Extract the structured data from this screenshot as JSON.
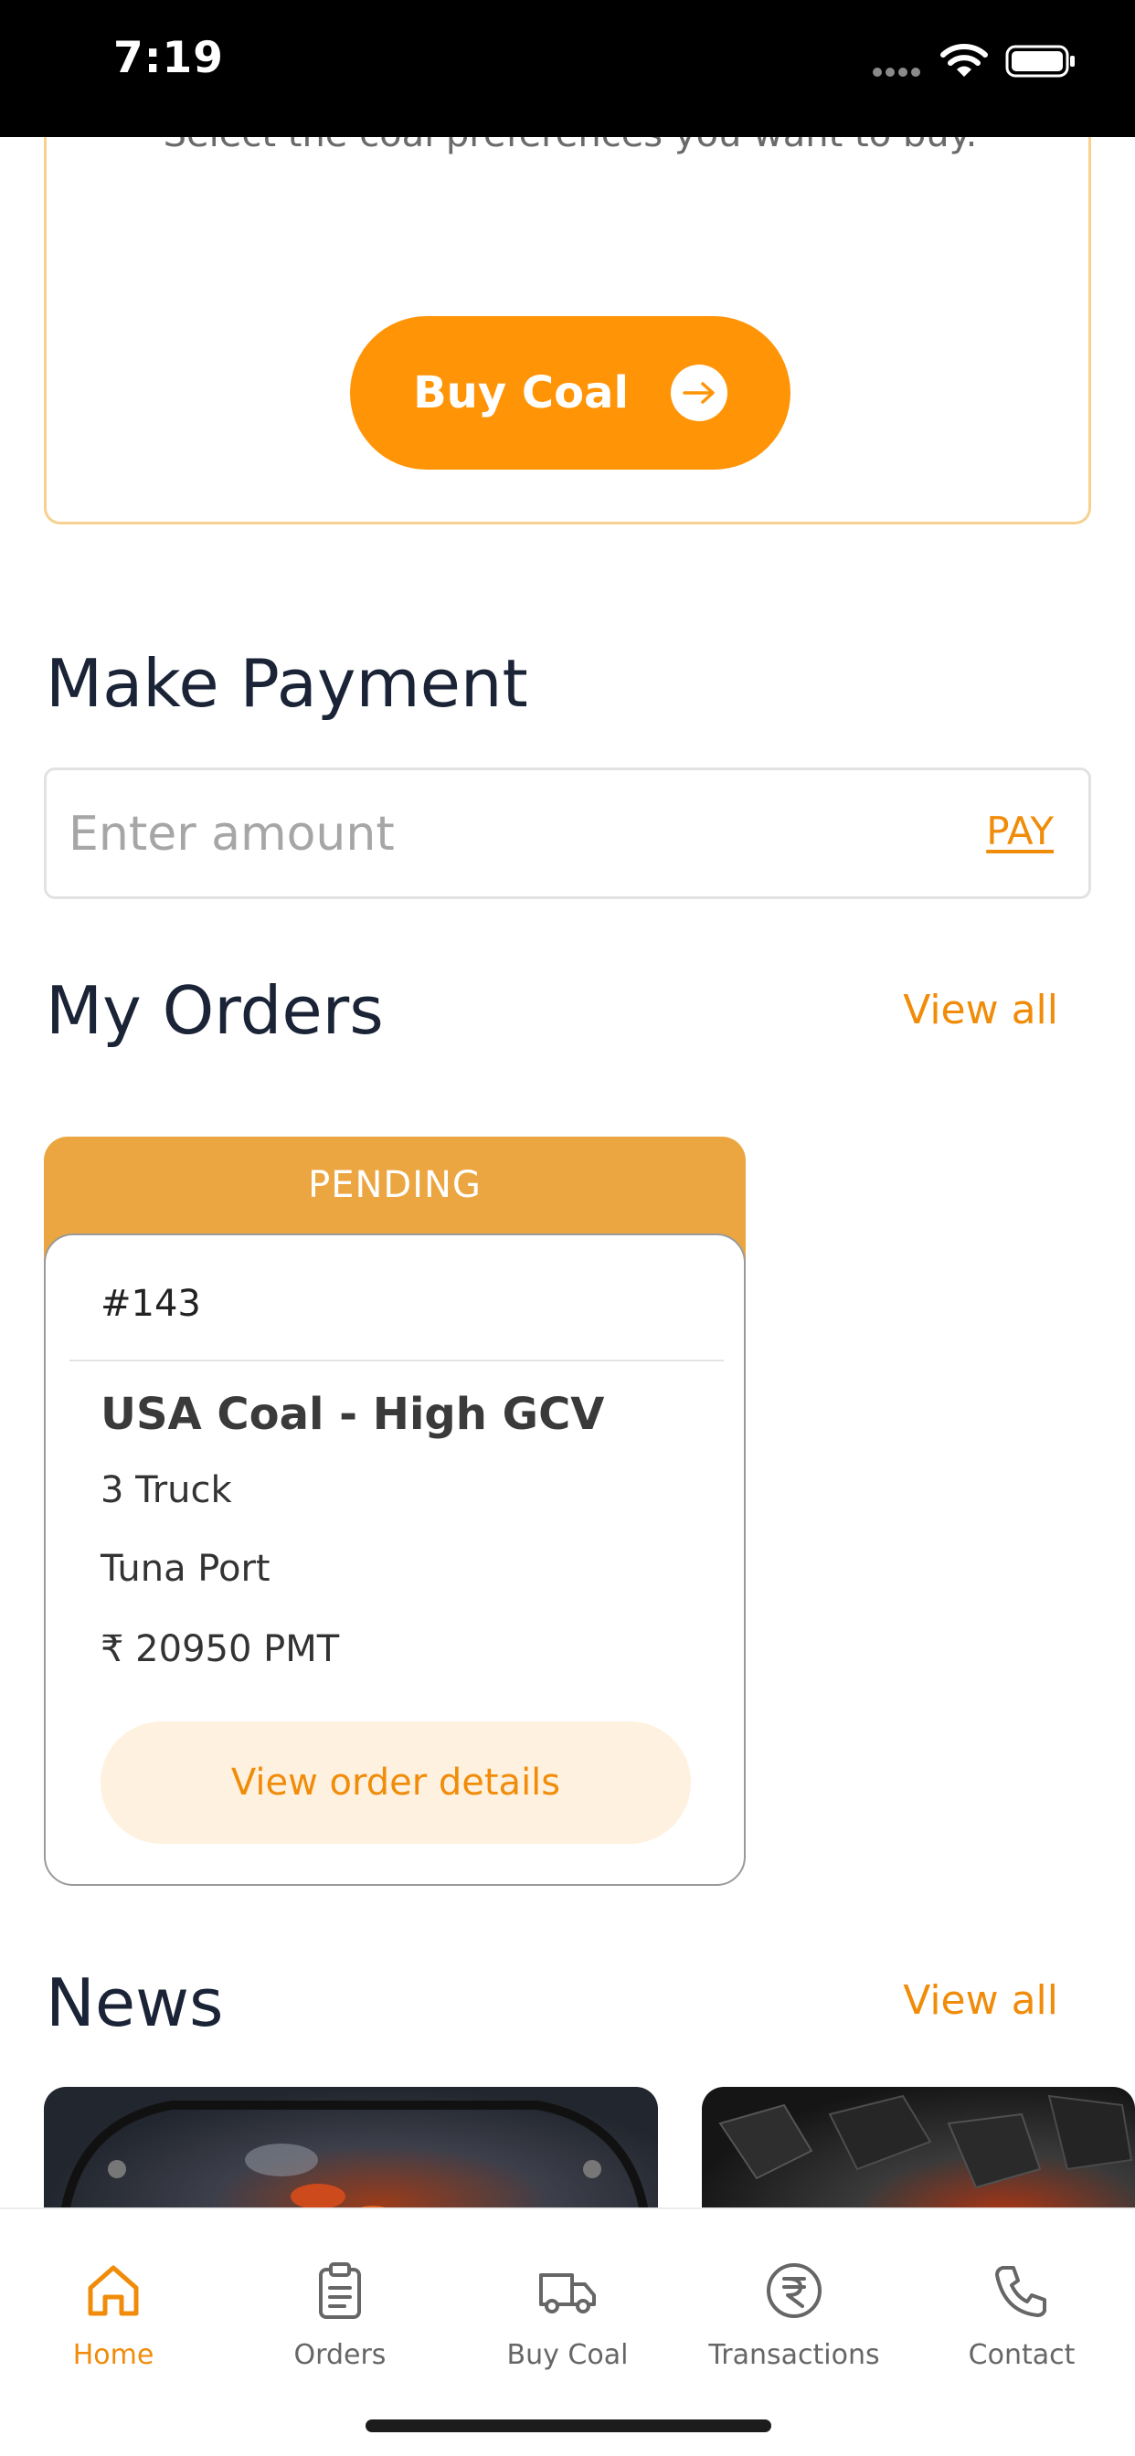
{
  "status_bar": {
    "time": "7:19"
  },
  "buy_section": {
    "description": "Select the coal preferences you want to buy.",
    "button_label": "Buy Coal"
  },
  "payment": {
    "title": "Make Payment",
    "input_placeholder": "Enter amount",
    "input_value": "",
    "pay_label": "PAY"
  },
  "orders": {
    "title": "My Orders",
    "view_all_label": "View all",
    "items": [
      {
        "status": "PENDING",
        "id": "#143",
        "product": "USA Coal - High GCV",
        "quantity": "3 Truck",
        "port": "Tuna Port",
        "price": "₹ 20950 PMT",
        "details_label": "View order details"
      }
    ]
  },
  "news": {
    "title": "News",
    "view_all_label": "View all"
  },
  "bottom_nav": {
    "items": [
      {
        "label": "Home",
        "icon": "home-icon",
        "active": true
      },
      {
        "label": "Orders",
        "icon": "clipboard-icon",
        "active": false
      },
      {
        "label": "Buy Coal",
        "icon": "truck-icon",
        "active": false
      },
      {
        "label": "Transactions",
        "icon": "rupee-icon",
        "active": false
      },
      {
        "label": "Contact",
        "icon": "phone-icon",
        "active": false
      }
    ]
  },
  "colors": {
    "accent": "#ff9407",
    "link": "#f08c0a",
    "pending": "#eba641",
    "heading": "#1b2437"
  }
}
